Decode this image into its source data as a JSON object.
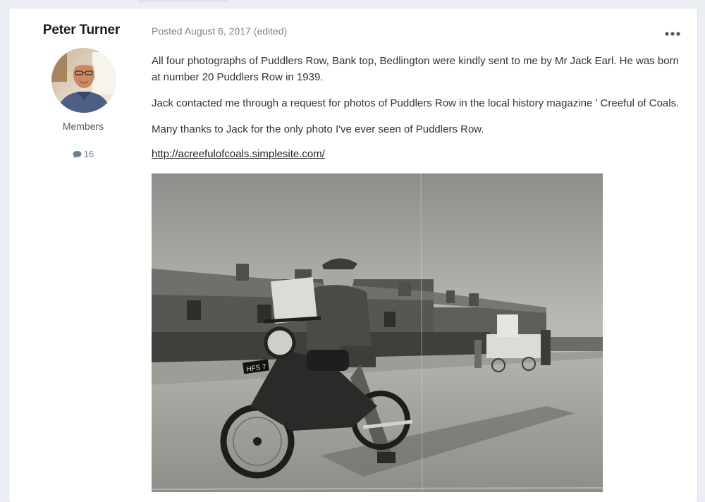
{
  "author": {
    "name": "Peter Turner",
    "group": "Members",
    "post_count": "16",
    "avatar_icon": "user-avatar-photo",
    "count_icon": "comment-icon"
  },
  "post": {
    "meta": "Posted August 6, 2017 (edited)",
    "menu_icon": "ellipsis-icon",
    "paragraphs": [
      "All four photographs of Puddlers Row, Bank top, Bedlington were kindly sent to me by Mr Jack Earl. He was born at number 20 Puddlers Row in 1939.",
      "Jack contacted me through a request for photos of Puddlers Row in the local history magazine ' Creeful of Coals.",
      "Many thanks to Jack for the only photo I've ever seen of Puddlers Row."
    ],
    "link": "http://acreefulofcoals.simplesite.com/",
    "photo": {
      "plate": "HFS 7"
    }
  },
  "colors": {
    "page_background": "#ebeef2",
    "card_background": "#ffffff",
    "meta_text": "#7a8594",
    "count_text": "#6b7f95"
  }
}
